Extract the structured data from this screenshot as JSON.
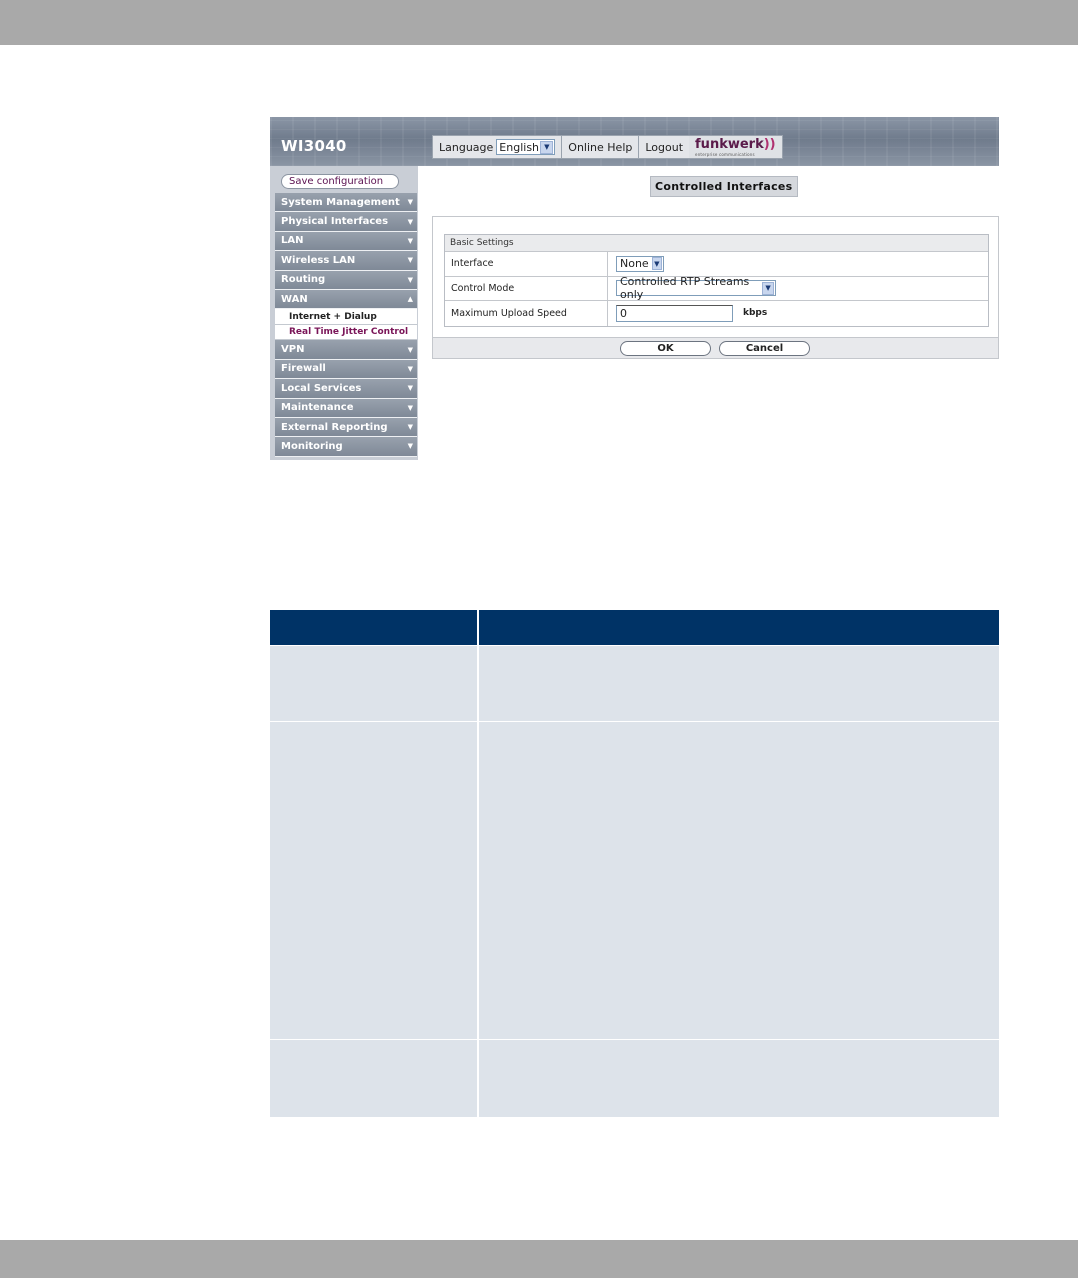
{
  "app": {
    "device_name": "WI3040",
    "toolbar": {
      "language_label": "Language",
      "language_value": "English",
      "online_help": "Online Help",
      "logout": "Logout",
      "logo_text": "funkwerk",
      "logo_tagline": "enterprise communications"
    },
    "sidebar": {
      "save_button": "Save configuration",
      "items_before": [
        {
          "label": "System Management"
        },
        {
          "label": "Physical Interfaces"
        },
        {
          "label": "LAN"
        },
        {
          "label": "Wireless LAN"
        },
        {
          "label": "Routing"
        }
      ],
      "wan": {
        "label": "WAN",
        "subitems": [
          {
            "label": "Internet + Dialup"
          },
          {
            "label": "Real Time Jitter Control"
          }
        ]
      },
      "items_after": [
        {
          "label": "VPN"
        },
        {
          "label": "Firewall"
        },
        {
          "label": "Local Services"
        },
        {
          "label": "Maintenance"
        },
        {
          "label": "External Reporting"
        },
        {
          "label": "Monitoring"
        }
      ]
    },
    "main": {
      "tab_title": "Controlled Interfaces",
      "group_title": "Basic Settings",
      "fields": {
        "interface_label": "Interface",
        "interface_value": "None",
        "control_mode_label": "Control Mode",
        "control_mode_value": "Controlled RTP Streams only",
        "max_upload_label": "Maximum Upload Speed",
        "max_upload_value": "0",
        "max_upload_unit": "kbps"
      },
      "buttons": {
        "ok": "OK",
        "cancel": "Cancel"
      }
    }
  },
  "colors": {
    "table_header": "#003366",
    "table_body": "#dde3ea",
    "page_band": "#a9a9a9",
    "active_subitem": "#7a1558"
  }
}
